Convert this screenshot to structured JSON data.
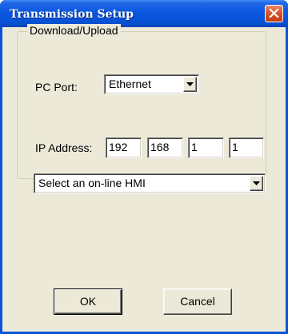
{
  "window": {
    "title": "Transmission Setup"
  },
  "icons": {
    "close": "close-icon",
    "dropdown": "chevron-down-icon"
  },
  "colors": {
    "titlebar": "#0a56e0",
    "close_button": "#d9542a",
    "dialog_background": "#ece9d8"
  },
  "group": {
    "title": "Download/Upload"
  },
  "pc_port": {
    "label": "PC Port:",
    "value": "Ethernet"
  },
  "ip_address": {
    "label": "IP Address:",
    "octets": [
      "192",
      "168",
      "1",
      "1"
    ]
  },
  "hmi_select": {
    "value": "Select an on-line HMI"
  },
  "buttons": {
    "ok": "OK",
    "cancel": "Cancel"
  }
}
